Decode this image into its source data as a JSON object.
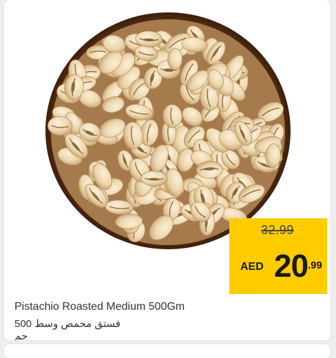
{
  "product": {
    "image_icon": "pistachio-bowl",
    "title_en": "Pistachio Roasted Medium 500Gm",
    "title_ar": "فستق محمص وسط 500 جم"
  },
  "price": {
    "old": "32.99",
    "currency": "AED",
    "main": "20",
    "cents": ".99",
    "tag_color": "#ffcc00"
  }
}
